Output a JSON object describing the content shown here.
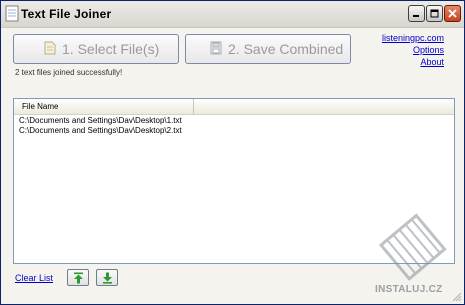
{
  "window": {
    "title": "Text File Joiner"
  },
  "toolbar": {
    "select_files_label": "1. Select File(s)",
    "save_combined_label": "2. Save Combined"
  },
  "status_text": "2 text files joined successfully!",
  "links": {
    "site": "listeningpc.com",
    "options": "Options",
    "about": "About"
  },
  "file_list": {
    "column_header": "File Name",
    "rows": [
      "C:\\Documents and Settings\\Dav\\Desktop\\1.txt",
      "C:\\Documents and Settings\\Dav\\Desktop\\2.txt"
    ]
  },
  "bottom": {
    "clear_list_label": "Clear List"
  },
  "watermark": {
    "text": "INSTALUJ.CZ"
  },
  "colors": {
    "link": "#0000cc",
    "arrow_green": "#2e9a2e",
    "close_red": "#c4441d"
  }
}
